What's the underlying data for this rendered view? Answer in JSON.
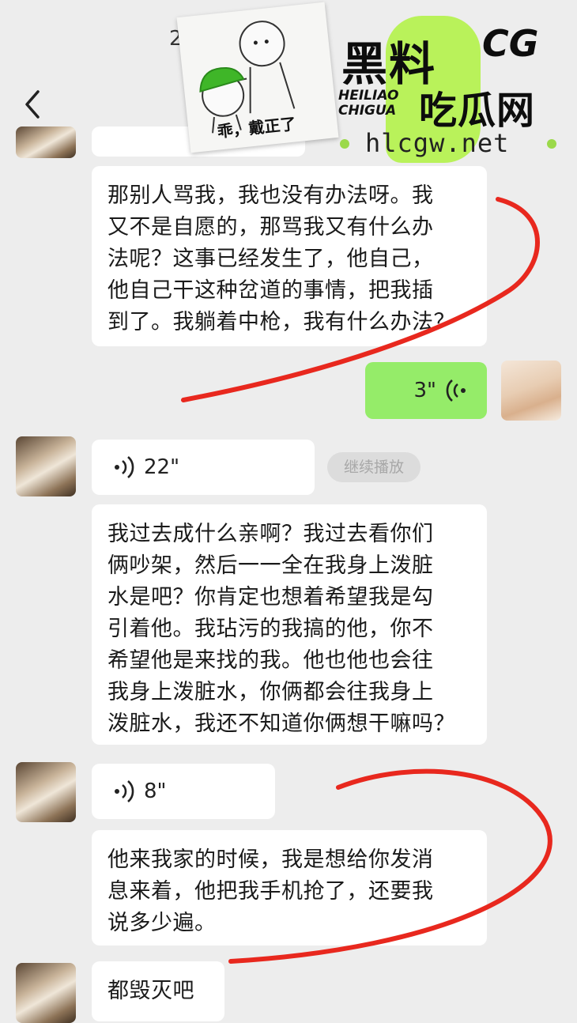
{
  "status_bar": {
    "time": "2:"
  },
  "messages": [
    {
      "id": "m1",
      "type": "text",
      "side": "left",
      "text": "那别人骂我，我也没有办法呀。我\n又不是自愿的，那骂我又有什么办\n法呢？这事已经发生了，他自己，\n他自己干这种岔道的事情，把我插\n到了。我躺着中枪，我有什么办法？"
    },
    {
      "id": "m2",
      "type": "voice",
      "side": "right",
      "duration": "3\""
    },
    {
      "id": "m3",
      "type": "voice",
      "side": "left",
      "duration": "22\"",
      "action": "继续播放"
    },
    {
      "id": "m4",
      "type": "text",
      "side": "left",
      "text": "我过去成什么亲啊？我过去看你们\n俩吵架，然后一一全在我身上泼脏\n水是吧？你肯定也想着希望我是勾\n引着他。我玷污的我搞的他，你不\n希望他是来找的我。他也他也会往\n我身上泼脏水，你俩都会往我身上\n泼脏水，我还不知道你俩想干嘛吗？"
    },
    {
      "id": "m5",
      "type": "voice",
      "side": "left",
      "duration": "8\""
    },
    {
      "id": "m6",
      "type": "text",
      "side": "left",
      "text": "他来我家的时候，我是想给你发消\n息来着，他把我手机抢了，还要我\n说多少遍。"
    },
    {
      "id": "m7",
      "type": "text",
      "side": "left",
      "text": "都毁灭吧"
    }
  ],
  "sticker": {
    "caption": "乖，戴正了"
  },
  "watermark": {
    "title": "黑料",
    "tag": "CG",
    "sub_line1": "HEILIAO",
    "sub_line2": "CHIGUA",
    "title2": "吃瓜网",
    "url": "hlcgw.net"
  },
  "colors": {
    "background": "#ededed",
    "bubble_white": "#ffffff",
    "bubble_green": "#95ec69",
    "annotation_red": "#e8281e",
    "watermark_green": "#b9f25a"
  }
}
